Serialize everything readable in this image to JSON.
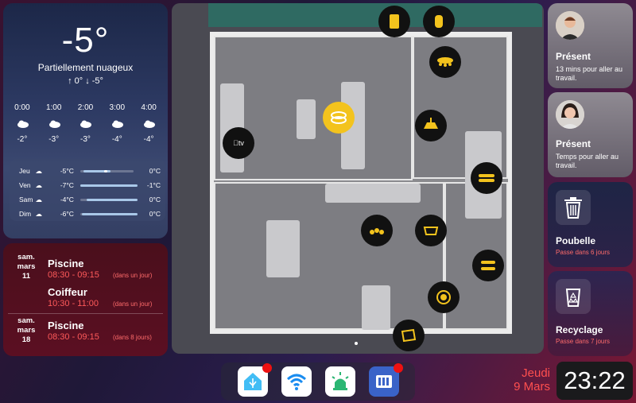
{
  "weather": {
    "temp": "-5°",
    "condition": "Partiellement nuageux",
    "hilo": "↑ 0° ↓ -5°",
    "hourly": [
      {
        "time": "0:00",
        "temp": "-2°"
      },
      {
        "time": "1:00",
        "temp": "-3°"
      },
      {
        "time": "2:00",
        "temp": "-3°"
      },
      {
        "time": "3:00",
        "temp": "-4°"
      },
      {
        "time": "4:00",
        "temp": "-4°"
      }
    ],
    "daily": [
      {
        "day": "Jeu",
        "low": "-5°C",
        "high": "0°C"
      },
      {
        "day": "Ven",
        "low": "-7°C",
        "high": "-1°C"
      },
      {
        "day": "Sam",
        "low": "-4°C",
        "high": "0°C"
      },
      {
        "day": "Dim",
        "low": "-6°C",
        "high": "0°C"
      }
    ]
  },
  "calendar": {
    "events": [
      {
        "date": "sam.\nmars\n11",
        "title": "Piscine",
        "time": "08:30 - 09:15",
        "rel": "(dans un jour)"
      },
      {
        "date": "",
        "title": "Coiffeur",
        "time": "10:30 - 11:00",
        "rel": "(dans un jour)"
      },
      {
        "date": "sam.\nmars\n18",
        "title": "Piscine",
        "time": "08:30 - 09:15",
        "rel": "(dans 8 jours)"
      }
    ]
  },
  "floorplan": {
    "tv_label": "tv"
  },
  "presence": [
    {
      "status": "Présent",
      "sub": "13 mins pour aller au travail."
    },
    {
      "status": "Présent",
      "sub": "Temps pour aller au travail."
    }
  ],
  "bins": [
    {
      "label": "Poubelle",
      "sub": "Passe dans 6 jours"
    },
    {
      "label": "Recyclage",
      "sub": "Passe dans 7 jours"
    }
  ],
  "dock": {
    "apps": [
      "home-assistant",
      "wifi",
      "alarm",
      "network-storage"
    ]
  },
  "datetime": {
    "day": "Jeudi",
    "date": "9 Mars",
    "time": "23:22"
  },
  "colors": {
    "accent_red": "#ff4f4f",
    "light_on": "#f3c31d"
  }
}
